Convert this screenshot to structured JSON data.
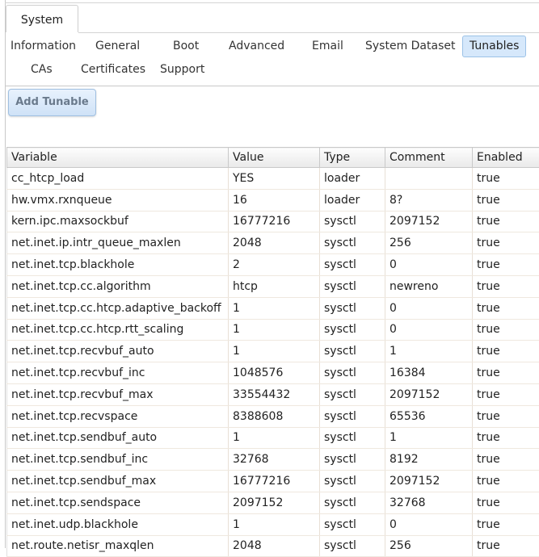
{
  "main_tab": "System",
  "subtabs": [
    {
      "label": "Information"
    },
    {
      "label": "General"
    },
    {
      "label": "Boot"
    },
    {
      "label": "Advanced"
    },
    {
      "label": "Email"
    },
    {
      "label": "System Dataset"
    },
    {
      "label": "Tunables"
    },
    {
      "label": "CAs"
    },
    {
      "label": "Certificates"
    },
    {
      "label": "Support"
    }
  ],
  "active_subtab": "Tunables",
  "add_button": "Add Tunable",
  "columns": [
    "Variable",
    "Value",
    "Type",
    "Comment",
    "Enabled"
  ],
  "rows": [
    [
      "cc_htcp_load",
      "YES",
      "loader",
      "",
      "true"
    ],
    [
      "hw.vmx.rxnqueue",
      "16",
      "loader",
      "8?",
      "true"
    ],
    [
      "kern.ipc.maxsockbuf",
      "16777216",
      "sysctl",
      "2097152",
      "true"
    ],
    [
      "net.inet.ip.intr_queue_maxlen",
      "2048",
      "sysctl",
      "256",
      "true"
    ],
    [
      "net.inet.tcp.blackhole",
      "2",
      "sysctl",
      "0",
      "true"
    ],
    [
      "net.inet.tcp.cc.algorithm",
      "htcp",
      "sysctl",
      "newreno",
      "true"
    ],
    [
      "net.inet.tcp.cc.htcp.adaptive_backoff",
      "1",
      "sysctl",
      "0",
      "true"
    ],
    [
      "net.inet.tcp.cc.htcp.rtt_scaling",
      "1",
      "sysctl",
      "0",
      "true"
    ],
    [
      "net.inet.tcp.recvbuf_auto",
      "1",
      "sysctl",
      "1",
      "true"
    ],
    [
      "net.inet.tcp.recvbuf_inc",
      "1048576",
      "sysctl",
      "16384",
      "true"
    ],
    [
      "net.inet.tcp.recvbuf_max",
      "33554432",
      "sysctl",
      "2097152",
      "true"
    ],
    [
      "net.inet.tcp.recvspace",
      "8388608",
      "sysctl",
      "65536",
      "true"
    ],
    [
      "net.inet.tcp.sendbuf_auto",
      "1",
      "sysctl",
      "1",
      "true"
    ],
    [
      "net.inet.tcp.sendbuf_inc",
      "32768",
      "sysctl",
      "8192",
      "true"
    ],
    [
      "net.inet.tcp.sendbuf_max",
      "16777216",
      "sysctl",
      "2097152",
      "true"
    ],
    [
      "net.inet.tcp.sendspace",
      "2097152",
      "sysctl",
      "32768",
      "true"
    ],
    [
      "net.inet.udp.blackhole",
      "1",
      "sysctl",
      "0",
      "true"
    ],
    [
      "net.route.netisr_maxqlen",
      "2048",
      "sysctl",
      "256",
      "true"
    ]
  ],
  "colors": {
    "accent": "#d6e8fb",
    "accent_border": "#9cc2e7",
    "button_text": "#6a7a8c"
  }
}
